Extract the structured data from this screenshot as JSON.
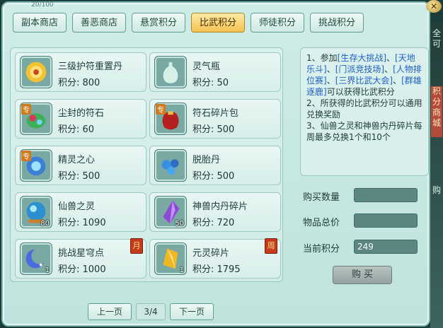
{
  "window": {
    "close_label": "✕",
    "top_small": "20/100"
  },
  "tabs": [
    {
      "label": "副本商店",
      "active": false
    },
    {
      "label": "善恶商店",
      "active": false
    },
    {
      "label": "悬赏积分",
      "active": false
    },
    {
      "label": "比武积分",
      "active": true
    },
    {
      "label": "师徒积分",
      "active": false
    },
    {
      "label": "挑战积分",
      "active": false
    }
  ],
  "items": [
    {
      "name": "三级护符重置丹",
      "points": "积分: 800",
      "icon": "gold-flower-pill-icon",
      "badge": "",
      "count": "",
      "corner": ""
    },
    {
      "name": "灵气瓶",
      "points": "积分: 50",
      "icon": "spirit-vase-icon",
      "badge": "",
      "count": "",
      "corner": ""
    },
    {
      "name": "尘封的符石",
      "points": "积分: 60",
      "icon": "sealed-rune-stone-icon",
      "badge": "专",
      "count": "",
      "corner": ""
    },
    {
      "name": "符石碎片包",
      "points": "积分: 500",
      "icon": "rune-shard-bag-icon",
      "badge": "专",
      "count": "",
      "corner": ""
    },
    {
      "name": "精灵之心",
      "points": "积分: 500",
      "icon": "spirit-heart-icon",
      "badge": "专",
      "count": "",
      "corner": ""
    },
    {
      "name": "脱胎丹",
      "points": "积分: 500",
      "icon": "rebirth-pill-icon",
      "badge": "",
      "count": "",
      "corner": ""
    },
    {
      "name": "仙兽之灵",
      "points": "积分: 1090",
      "icon": "beast-spirit-orb-icon",
      "badge": "",
      "count": "80",
      "corner": ""
    },
    {
      "name": "神兽内丹碎片",
      "points": "积分: 720",
      "icon": "purple-crystal-icon",
      "badge": "",
      "count": "50",
      "corner": ""
    },
    {
      "name": "挑战星穹点",
      "points": "积分: 1000",
      "icon": "crescent-moon-icon",
      "badge": "",
      "count": "1",
      "corner": "月"
    },
    {
      "name": "元灵碎片",
      "points": "积分: 1795",
      "icon": "gold-shard-icon",
      "badge": "",
      "count": "1",
      "corner": "周"
    }
  ],
  "info": {
    "line1_prefix": "1、参加",
    "event_a": "[生存大挑战]",
    "sep1": "、",
    "event_b": "[天地乐斗]",
    "sep2": "、",
    "event_c": "[门派竞技场]",
    "sep3": "、",
    "event_d": "[人物排位赛]",
    "sep4": "、",
    "event_e": "[三界比武大会]",
    "sep5": "、",
    "event_f": "[群雄逐鹿]",
    "line1_suffix": "可以获得比武积分",
    "line2": "2、所获得的比武积分可以通用兑换奖励",
    "line3": "3、仙兽之灵和神兽内丹碎片每周最多兑换1个和10个"
  },
  "form": {
    "buy_qty_label": "购买数量",
    "buy_qty_value": "",
    "total_label": "物品总价",
    "total_value": "",
    "current_label": "当前积分",
    "current_value": "249",
    "buy_button": "购 买"
  },
  "pager": {
    "prev": "上一页",
    "page": "3/4",
    "next": "下一页"
  },
  "side": {
    "text1": "全可",
    "text2": "积分商城",
    "text3": "购"
  }
}
